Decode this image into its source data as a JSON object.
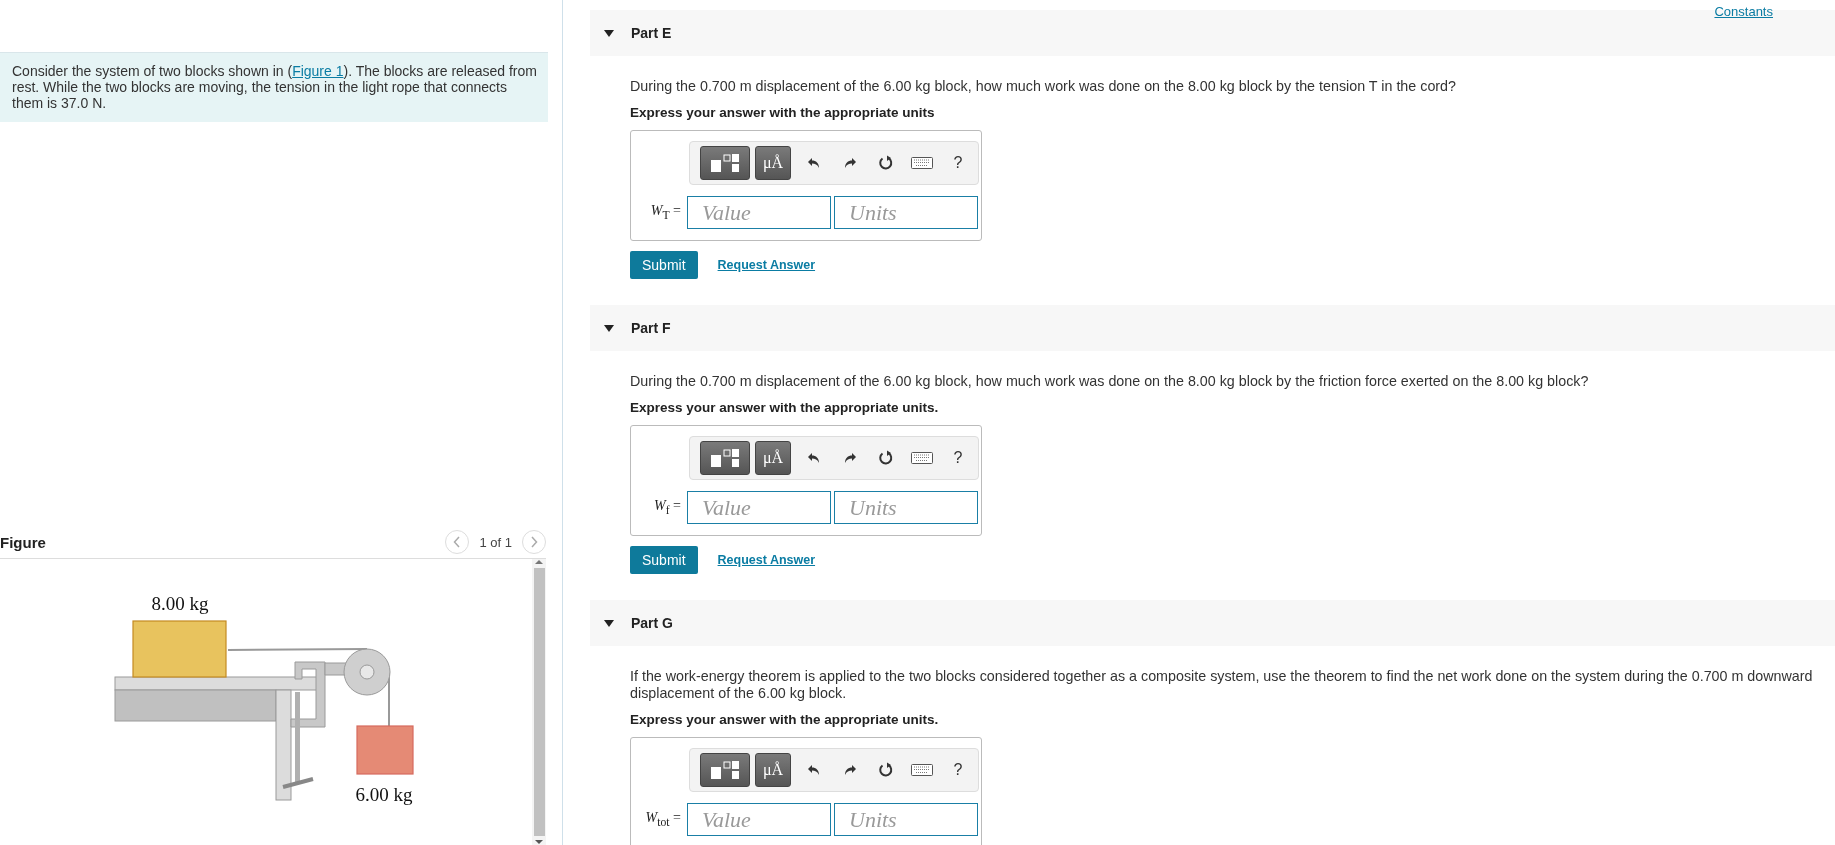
{
  "intro": {
    "text": "Consider the system of two blocks shown in (",
    "link": "Figure 1",
    "text_after": "). The blocks are released from rest. While the two blocks are moving, the tension in the light rope that connects them is 37.0 N."
  },
  "figure": {
    "title": "Figure",
    "pager": "1 of 1",
    "labels": [
      "8.00 kg",
      "6.00 kg"
    ]
  },
  "header_link": "Constants",
  "parts": [
    {
      "title": "Part E",
      "expanded": true,
      "question": "During the 0.700 m displacement of the 6.00 kg block, how much work was done on the 8.00 kg block by the tension T in the cord?",
      "instruction": "Express your answer with the appropriate units",
      "units_button": "μÅ",
      "help": "?",
      "label": "*W*$_{T}$ =",
      "value_placeholder": "Value",
      "units_placeholder": "Units",
      "submit": "Submit",
      "request": "Request Answer"
    },
    {
      "title": "Part F",
      "expanded": true,
      "question": "During the 0.700 m displacement of the 6.00 kg block, how much work was done on the 8.00 kg block by the friction force exerted on the 8.00 kg block?",
      "instruction": "Express your answer with the appropriate units.",
      "units_button": "μÅ",
      "help": "?",
      "label": "*W*$_{f}$ =",
      "value_placeholder": "Value",
      "units_placeholder": "Units",
      "submit": "Submit",
      "request": "Request Answer"
    },
    {
      "title": "Part G",
      "expanded": true,
      "question": "If the work-energy theorem is applied to the two blocks considered together as a composite system, use the theorem to find the net work done on the system during the 0.700 m downward displacement of the 6.00 kg block.",
      "instruction": "Express your answer with the appropriate units.",
      "units_button": "μÅ",
      "help": "?",
      "label": "*W*$_{tot}$ =",
      "value_placeholder": "Value",
      "units_placeholder": "Units"
    }
  ]
}
